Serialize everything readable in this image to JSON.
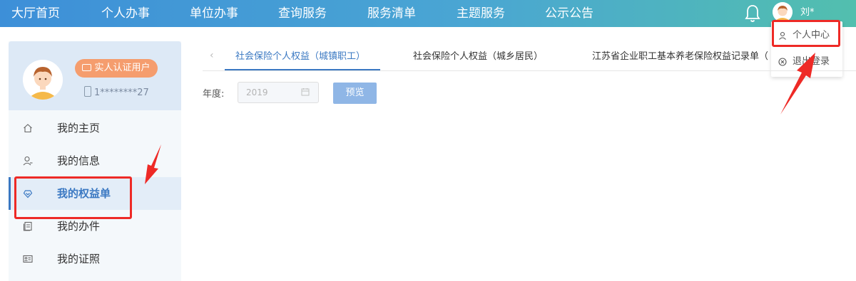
{
  "nav": {
    "items": [
      "大厅首页",
      "个人办事",
      "单位办事",
      "查询服务",
      "服务清单",
      "主题服务",
      "公示公告"
    ],
    "user_name": "刘*"
  },
  "dropdown": {
    "personal_center": "个人中心",
    "logout": "退出登录"
  },
  "profile": {
    "auth_badge": "实人认证用户",
    "phone": "1********27"
  },
  "sidebar": {
    "items": [
      {
        "label": "我的主页",
        "icon": "home-icon"
      },
      {
        "label": "我的信息",
        "icon": "user-icon"
      },
      {
        "label": "我的权益单",
        "icon": "heart-shield-icon"
      },
      {
        "label": "我的办件",
        "icon": "document-icon"
      },
      {
        "label": "我的证照",
        "icon": "id-card-icon"
      }
    ],
    "active_index": 2
  },
  "tabs": [
    "社会保险个人权益（城镇职工）",
    "社会保险个人权益（城乡居民）",
    "江苏省企业职工基本养老保险权益记录单（"
  ],
  "form": {
    "year_label": "年度:",
    "year_value": "2019",
    "preview_label": "预览"
  },
  "colors": {
    "accent": "#3a78c2",
    "highlight_red": "#ee2a26",
    "badge_orange": "#f59d6e"
  }
}
